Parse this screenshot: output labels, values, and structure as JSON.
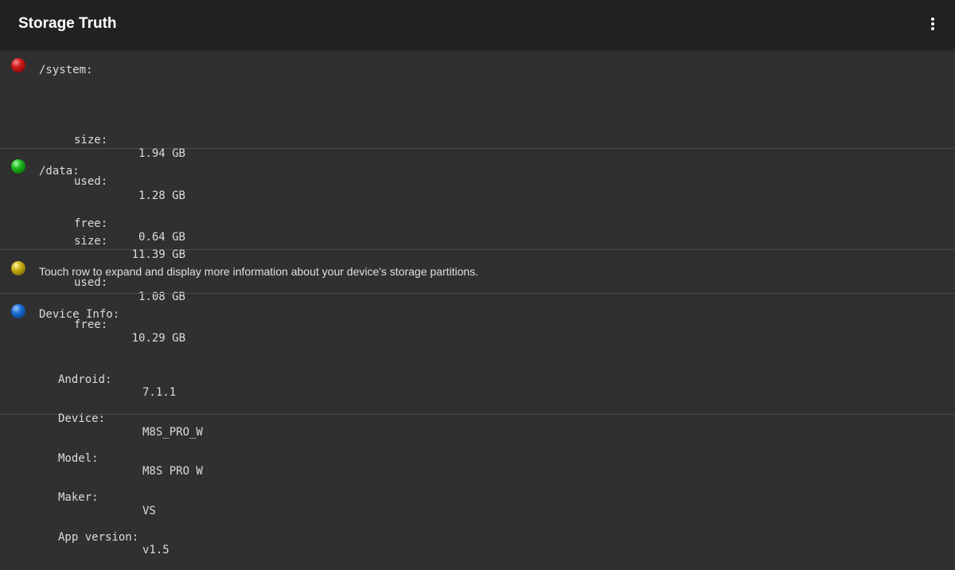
{
  "app": {
    "title": "Storage Truth",
    "menu_icon": "more-vert-icon"
  },
  "partitions": [
    {
      "name": "/system:",
      "indicator_color": "#d11c1c",
      "stats": [
        {
          "label": "size:",
          "value": "1.94 GB"
        },
        {
          "label": "used:",
          "value": "1.28 GB"
        },
        {
          "label": "free:",
          "value": "0.64 GB"
        }
      ]
    },
    {
      "name": "/data:",
      "indicator_color": "#1fb81f",
      "stats": [
        {
          "label": "size:",
          "value": "11.39 GB"
        },
        {
          "label": "used:",
          "value": "1.08 GB"
        },
        {
          "label": "free:",
          "value": "10.29 GB"
        }
      ]
    }
  ],
  "hint": {
    "indicator_color": "#c9b114",
    "text": "Touch row to expand and display more information about your device's storage partitions."
  },
  "device_info": {
    "title": "Device Info:",
    "indicator_color": "#1d6fd6",
    "items": [
      {
        "label": "Android:",
        "value": "7.1.1"
      },
      {
        "label": "Device:",
        "value": "M8S_PRO_W"
      },
      {
        "label": "Model:",
        "value": "M8S PRO W"
      },
      {
        "label": "Maker:",
        "value": "VS"
      },
      {
        "label": "App version:",
        "value": "v1.5"
      }
    ]
  }
}
